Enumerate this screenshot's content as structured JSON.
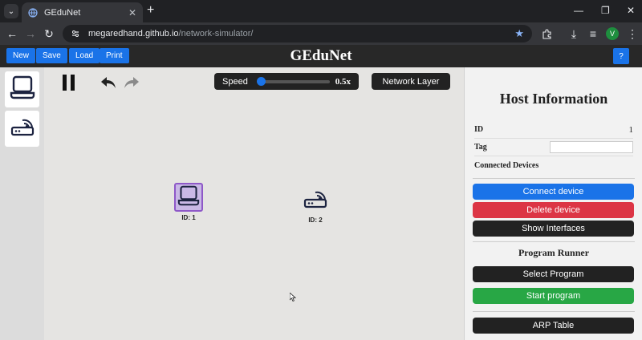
{
  "browser": {
    "tab_title": "GEduNet",
    "url_host": "megaredhand.github.io",
    "url_path": "/network-simulator/",
    "profile_initial": "V"
  },
  "header": {
    "buttons": [
      "New",
      "Save",
      "Load",
      "Print"
    ],
    "title": "GEduNet",
    "help": "?"
  },
  "palette": {
    "items": [
      "host-icon",
      "router-icon"
    ]
  },
  "canvas": {
    "speed_label": "Speed",
    "speed_value": "0.5x",
    "speed_fraction": 0.0,
    "layer_button": "Network Layer",
    "nodes": [
      {
        "label": "ID: 1",
        "type": "host",
        "selected": true
      },
      {
        "label": "ID: 2",
        "type": "router",
        "selected": false
      }
    ]
  },
  "panel": {
    "title": "Host Information",
    "id_label": "ID",
    "id_value": "1",
    "tag_label": "Tag",
    "tag_value": "",
    "connected_label": "Connected Devices",
    "connect_button": "Connect device",
    "delete_button": "Delete device",
    "interfaces_button": "Show Interfaces",
    "runner_title": "Program Runner",
    "select_program_button": "Select Program",
    "start_program_button": "Start program",
    "arp_button": "ARP Table"
  },
  "colors": {
    "primary": "#1a73e8",
    "danger": "#dc3545",
    "success": "#28a745",
    "dark": "#222222",
    "selected": "#8e58c8"
  }
}
